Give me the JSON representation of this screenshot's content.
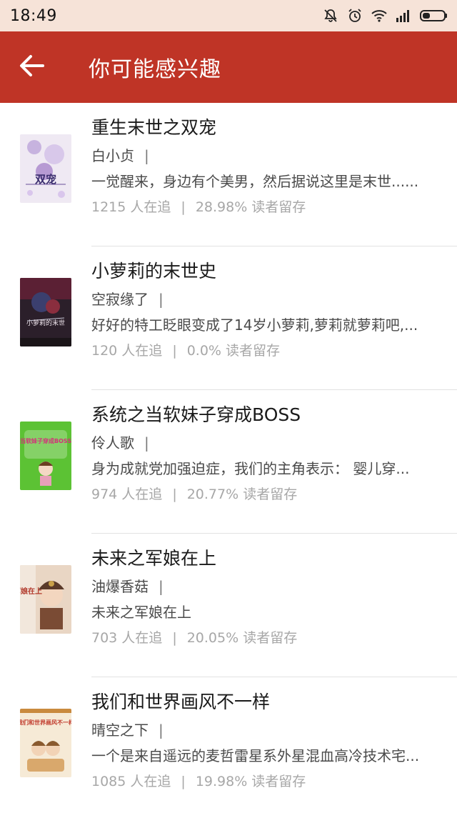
{
  "status_bar": {
    "time": "18:49",
    "icons": [
      "mute-icon",
      "alarm-icon",
      "wifi-icon",
      "signal-icon",
      "battery-icon"
    ]
  },
  "header": {
    "title": "你可能感兴趣",
    "back_icon": "arrow-left-icon",
    "background": "#bf3426"
  },
  "books": [
    {
      "title": "重生末世之双宠",
      "author": "白小贞",
      "separator": "|",
      "description": "一觉醒来，身边有个美男，然后据说这里是末世......",
      "followers": "1215 人在追",
      "retention": "28.98% 读者留存",
      "cover": {
        "icon": "book-cover",
        "caption": "双宠"
      }
    },
    {
      "title": "小萝莉的末世史",
      "author": "空寂缘了",
      "separator": "|",
      "description": "好好的特工眨眼变成了14岁小萝莉,萝莉就萝莉吧,...",
      "followers": "120 人在追",
      "retention": "0.0% 读者留存",
      "cover": {
        "icon": "book-cover",
        "caption": "小萝莉的末世"
      }
    },
    {
      "title": "系统之当软妹子穿成BOSS",
      "author": "伶人歌",
      "separator": "|",
      "description": "身为成就党加强迫症，我们的主角表示： 婴儿穿...",
      "followers": "974 人在追",
      "retention": "20.77% 读者留存",
      "cover": {
        "icon": "book-cover",
        "caption": "当软妹子穿成BOSS"
      }
    },
    {
      "title": "未来之军娘在上",
      "author": "油爆香菇",
      "separator": "|",
      "description": "未来之军娘在上",
      "followers": "703 人在追",
      "retention": "20.05% 读者留存",
      "cover": {
        "icon": "book-cover",
        "caption": "军娘在上"
      }
    },
    {
      "title": "我们和世界画风不一样",
      "author": "晴空之下",
      "separator": "|",
      "description": "一个是来自遥远的麦哲雷星系外星混血高冷技术宅...",
      "followers": "1085 人在追",
      "retention": "19.98% 读者留存",
      "cover": {
        "icon": "book-cover",
        "caption": "我们和世界画风不一样"
      }
    }
  ]
}
